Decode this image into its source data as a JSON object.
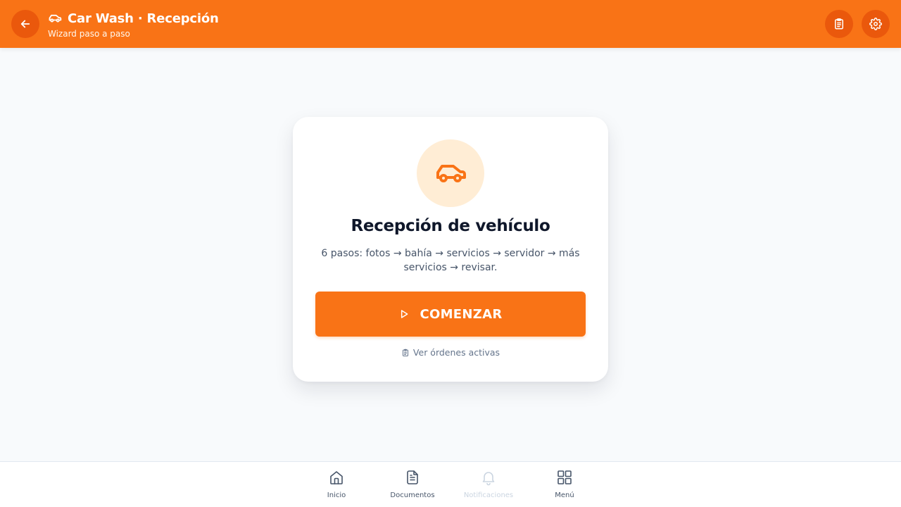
{
  "header": {
    "title": "Car Wash · Recepción",
    "subtitle": "Wizard paso a paso",
    "back_icon": "arrow-left-icon",
    "title_icon": "car-icon",
    "orders_icon": "clipboard-icon",
    "settings_icon": "gear-icon"
  },
  "card": {
    "icon": "car-icon",
    "title": "Recepción de vehículo",
    "description": "6 pasos: fotos → bahía → servicios → servidor → más servicios → revisar.",
    "start_button": {
      "label": "COMENZAR",
      "icon": "play-icon"
    },
    "orders_link": {
      "label": "Ver órdenes activas",
      "icon": "clipboard-icon"
    }
  },
  "bottom_nav": {
    "items": [
      {
        "label": "Inicio",
        "icon": "home-icon",
        "enabled": true
      },
      {
        "label": "Documentos",
        "icon": "document-icon",
        "enabled": true
      },
      {
        "label": "Notificaciones",
        "icon": "bell-icon",
        "enabled": false
      },
      {
        "label": "Menú",
        "icon": "grid-icon",
        "enabled": true
      }
    ]
  },
  "colors": {
    "accent": "#f97316",
    "accent_dark": "#ea580c",
    "accent_light": "#ffedd5",
    "background": "#f8fafc",
    "text": "#0f172a",
    "muted": "#64748b"
  }
}
